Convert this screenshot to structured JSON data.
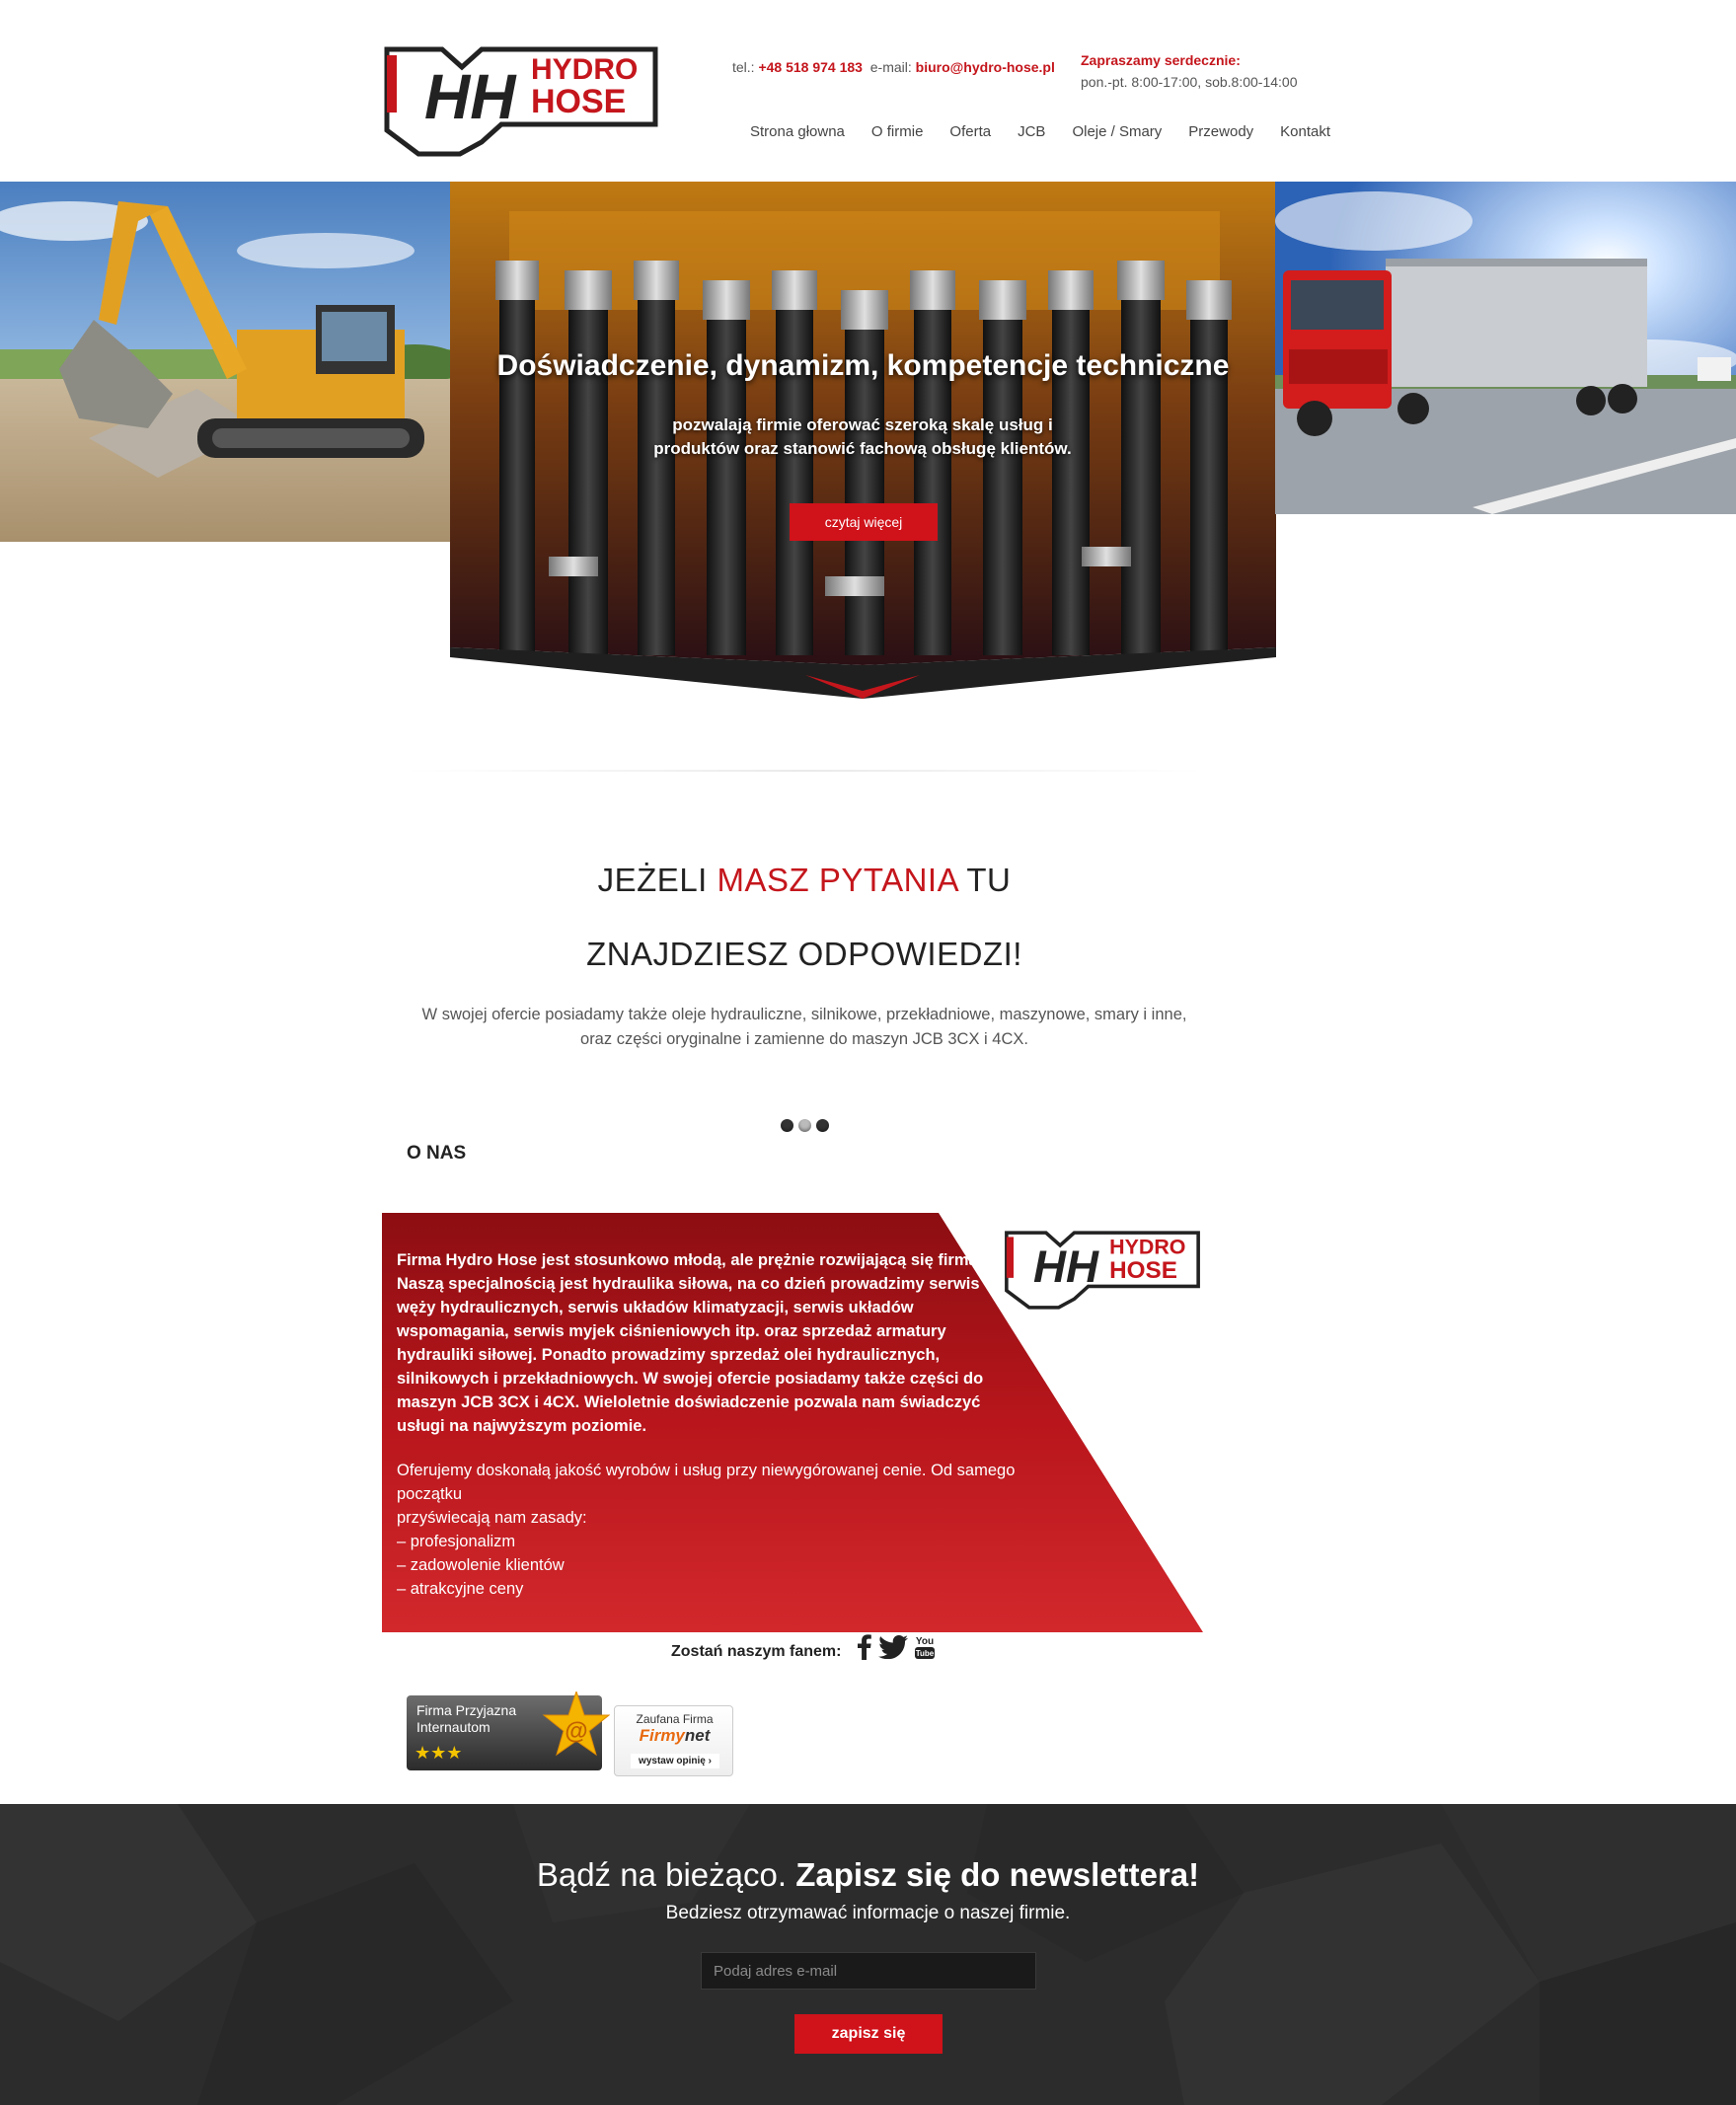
{
  "brand": {
    "logo_line1": "HYDRO",
    "logo_line2": "HOSE",
    "logo_monogram": "HH",
    "red": "#c4161c",
    "dark": "#222222"
  },
  "header": {
    "tel_label": "tel.:",
    "tel_value": "+48 518 974 183",
    "email_label": "e-mail:",
    "email_value": "biuro@hydro-hose.pl",
    "hours_title": "Zapraszamy serdecznie:",
    "hours_text": "pon.-pt. 8:00-17:00, sob.8:00-14:00"
  },
  "nav": [
    {
      "label": "Strona głowna"
    },
    {
      "label": "O firmie"
    },
    {
      "label": "Oferta"
    },
    {
      "label": "JCB"
    },
    {
      "label": "Oleje / Smary"
    },
    {
      "label": "Przewody"
    },
    {
      "label": "Kontakt"
    }
  ],
  "hero": {
    "headline": "Doświadczenie, dynamizm, kompetencje techniczne",
    "subline1": "pozwalają firmie oferować szeroką skalę usług i",
    "subline2": "produktów oraz stanowić fachową obsługę klientów.",
    "button": "czytaj więcej"
  },
  "questions": {
    "part1": "JEŻELI ",
    "part2": "MASZ PYTANIA",
    "part3": " TU",
    "line2": "ZNAJDZIESZ ODPOWIEDZI!",
    "text1": "W swojej ofercie posiadamy także oleje hydrauliczne, silnikowe, przekładniowe, maszynowe, smary i inne,",
    "text2": "oraz części oryginalne i zamienne do maszyn JCB 3CX i 4CX."
  },
  "slider": {
    "dots": 3,
    "active_index": 1
  },
  "about": {
    "title": "O NAS",
    "bold_text": "Firma Hydro Hose jest stosunkowo młodą, ale prężnie rozwijającą się firmą. Naszą specjalnością jest hydraulika siłowa, na co dzień prowadzimy serwis węży hydraulicznych, serwis układów klimatyzacji, serwis układów wspomagania, serwis myjek ciśnieniowych itp. oraz sprzedaż armatury hydrauliki siłowej. Ponadto prowadzimy sprzedaż olei hydraulicznych, silnikowych i przekładniowych. W swojej ofercie posiadamy także części do maszyn JCB 3CX i 4CX. Wieloletnie doświadczenie pozwala nam świadczyć usługi na najwyższym poziomie.",
    "para2_line1": "Oferujemy doskonałą jakość wyrobów i usług przy niewygórowanej cenie. Od samego",
    "para2_line2": "początku",
    "para2_line3": "przyświecają nam zasady:",
    "items": [
      "– profesjonalizm",
      "– zadowolenie klientów",
      "– atrakcyjne ceny"
    ]
  },
  "fan": {
    "label": "Zostań naszym fanem:",
    "icons": [
      "facebook-icon",
      "twitter-icon",
      "youtube-icon"
    ],
    "youtube_text_1": "You",
    "youtube_text_2": "Tube"
  },
  "badges": {
    "badge1_line1": "Firma Przyjazna",
    "badge1_line2": "Internautom",
    "badge1_stars": "★★★",
    "badge1_symbol": "@",
    "badge2_line1": "Zaufana Firma",
    "badge2_brand_a": "Firmy",
    "badge2_brand_b": "net",
    "badge2_cta": "wystaw opinię ›"
  },
  "newsletter": {
    "title_normal": "Bądź na bieżąco. ",
    "title_bold": "Zapisz się do newslettera!",
    "subtitle": "Bedziesz otrzymawać informacje o naszej firmie.",
    "placeholder": "Podaj adres e-mail",
    "button": "zapisz się"
  }
}
